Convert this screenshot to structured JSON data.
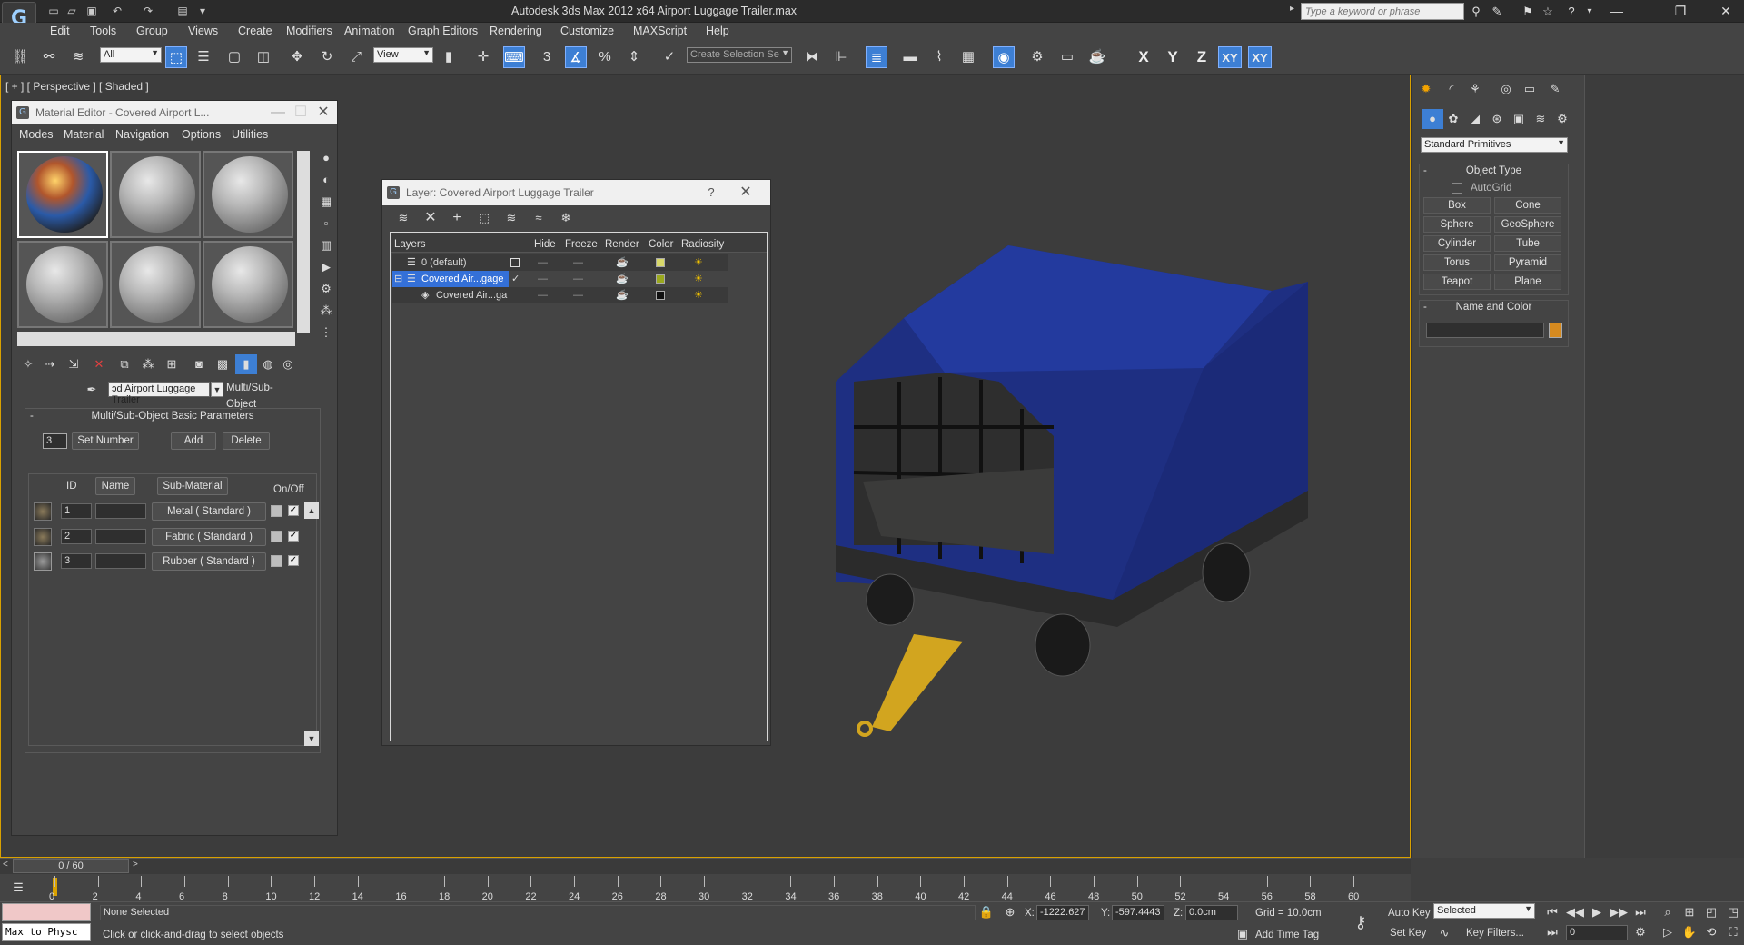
{
  "window": {
    "title": "Autodesk 3ds Max  2012 x64     Airport Luggage Trailer.max"
  },
  "search": {
    "placeholder": "Type a keyword or phrase"
  },
  "menu": [
    "Edit",
    "Tools",
    "Group",
    "Views",
    "Create",
    "Modifiers",
    "Animation",
    "Graph Editors",
    "Rendering",
    "Customize",
    "MAXScript",
    "Help"
  ],
  "toolbar": {
    "filter": "All",
    "ref_coord": "View",
    "named_sel": "Create Selection Se",
    "snap_label": "3",
    "axes": [
      "X",
      "Y",
      "Z",
      "XY",
      "XY"
    ]
  },
  "viewport": {
    "label": "[ + ] [ Perspective ] [ Shaded ]"
  },
  "material_editor": {
    "title": "Material Editor - Covered Airport L...",
    "menu": [
      "Modes",
      "Material",
      "Navigation",
      "Options",
      "Utilities"
    ],
    "material_name": "ɔd Airport Luggage Trailer",
    "material_type": "Multi/Sub-Object",
    "rollout": "Multi/Sub-Object Basic Parameters",
    "count": "3",
    "set_number": "Set Number",
    "add": "Add",
    "delete": "Delete",
    "headers": {
      "id": "ID",
      "name": "Name",
      "sub": "Sub-Material",
      "onoff": "On/Off"
    },
    "rows": [
      {
        "id": "1",
        "sub": "Metal  ( Standard )"
      },
      {
        "id": "2",
        "sub": "Fabric  ( Standard )"
      },
      {
        "id": "3",
        "sub": "Rubber  ( Standard )"
      }
    ]
  },
  "layer_dialog": {
    "title": "Layer: Covered Airport Luggage Trailer",
    "help": "?",
    "headers": {
      "layers": "Layers",
      "hide": "Hide",
      "freeze": "Freeze",
      "render": "Render",
      "color": "Color",
      "radiosity": "Radiosity"
    },
    "rows": [
      {
        "name": "0 (default)",
        "color": "#d8d86a"
      },
      {
        "name": "Covered Air...gage",
        "color": "#9aa81e"
      },
      {
        "name": "Covered Air...ga",
        "color": "#111111"
      }
    ]
  },
  "command_panel": {
    "category": "Standard Primitives",
    "object_type": "Object Type",
    "autogrid": "AutoGrid",
    "primitives": [
      "Box",
      "Cone",
      "Sphere",
      "GeoSphere",
      "Cylinder",
      "Tube",
      "Torus",
      "Pyramid",
      "Teapot",
      "Plane"
    ],
    "name_color": "Name and Color",
    "swatch_color": "#d68a1f"
  },
  "timeline": {
    "frame": "0 / 60",
    "ticks": [
      "0",
      "2",
      "4",
      "6",
      "8",
      "10",
      "12",
      "14",
      "16",
      "18",
      "20",
      "22",
      "24",
      "26",
      "28",
      "30",
      "32",
      "34",
      "36",
      "38",
      "40",
      "42",
      "44",
      "46",
      "48",
      "50",
      "52",
      "54",
      "56",
      "58",
      "60"
    ]
  },
  "status": {
    "script_listener": "Max to Physc",
    "selection": "None Selected",
    "prompt": "Click or click-and-drag to select objects",
    "x_label": "X:",
    "x": "-1222.627",
    "y_label": "Y:",
    "y": "-597.4443",
    "z_label": "Z:",
    "z": "0.0cm",
    "grid": "Grid = 10.0cm",
    "add_time_tag": "Add Time Tag",
    "auto_key": "Auto Key",
    "set_key": "Set Key",
    "key_mode": "Selected",
    "key_filters": "Key Filters...",
    "frame_field": "0"
  }
}
